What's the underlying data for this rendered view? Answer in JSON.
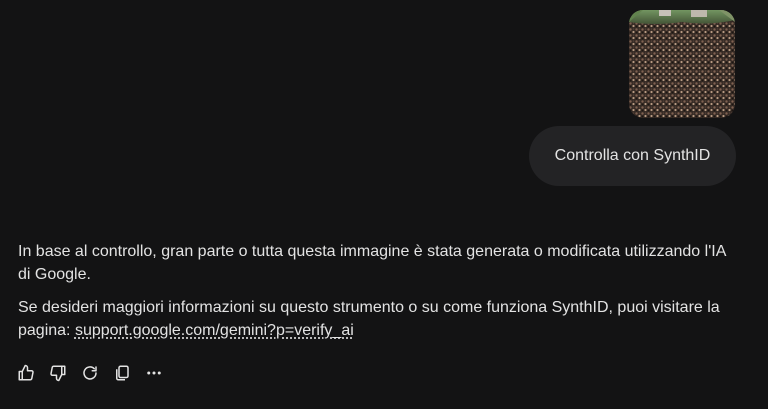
{
  "user_message": {
    "image_alt": "crowd-photo",
    "text": "Controlla con SynthID"
  },
  "response": {
    "paragraph1": "In base al controllo, gran parte o tutta questa immagine è stata generata o modificata utilizzando l'IA di Google.",
    "paragraph2_prefix": "Se desideri maggiori informazioni su questo strumento o su come funziona SynthID, puoi visitare la pagina: ",
    "link_text": "support.google.com/gemini?p=verify_ai"
  },
  "actions": [
    {
      "icon": "thumb-up-icon"
    },
    {
      "icon": "thumb-down-icon"
    },
    {
      "icon": "regenerate-icon"
    },
    {
      "icon": "copy-icon"
    },
    {
      "icon": "more-options-icon"
    }
  ],
  "colors": {
    "background": "#131314",
    "bubble": "#232325",
    "text": "#e3e3e3"
  }
}
